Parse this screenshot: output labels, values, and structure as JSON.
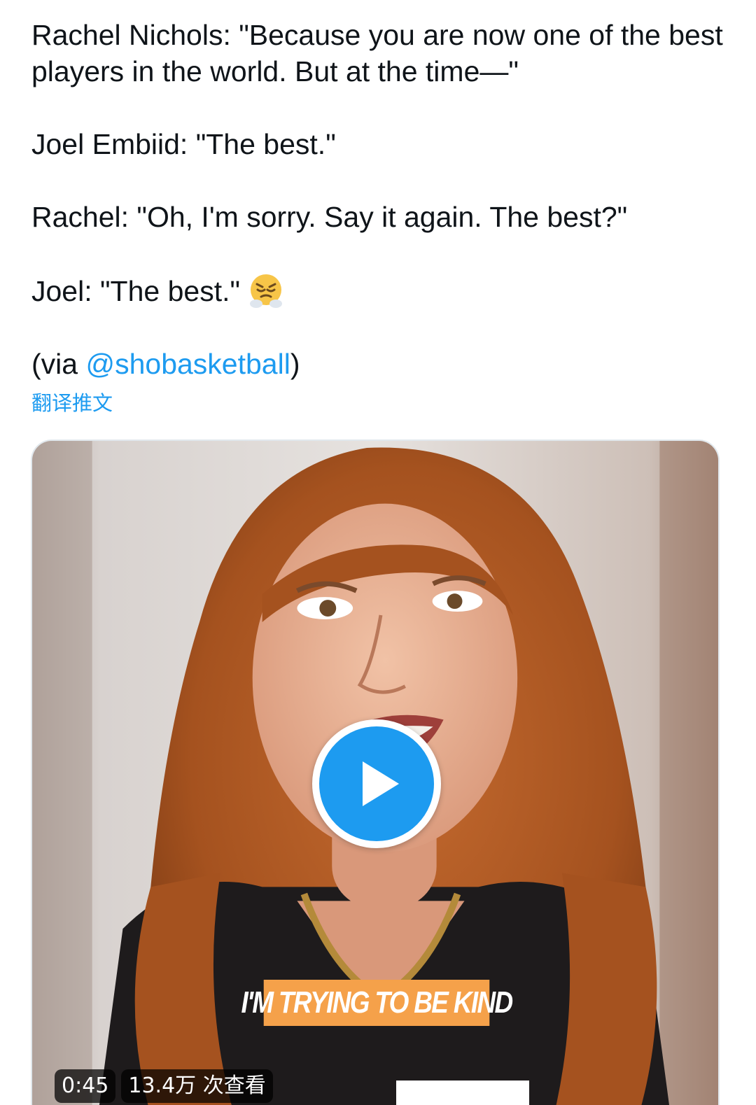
{
  "tweet": {
    "line1": "Rachel Nichols: \"Because you are now one of the best players in the world. But at the time—\"",
    "line2": "Joel Embiid: \"The best.\"",
    "line3": "Rachel: \"Oh, I'm sorry. Say it again. The best?\"",
    "line4": "Joel: \"The best.\"",
    "line4_emoji": "face-with-steam-from-nose",
    "via_prefix": "(via ",
    "via_mention": "@shobasketball",
    "via_suffix": ")",
    "translate_label": "翻译推文"
  },
  "media": {
    "caption": "I'M TRYING TO BE KIND",
    "duration": "0:45",
    "views": "13.4万 次查看",
    "play_icon": "play-icon"
  },
  "colors": {
    "link": "#1d9bf0",
    "text": "#0f1419",
    "play": "#1d9bf0",
    "caption_bg": "#f5a14a"
  }
}
